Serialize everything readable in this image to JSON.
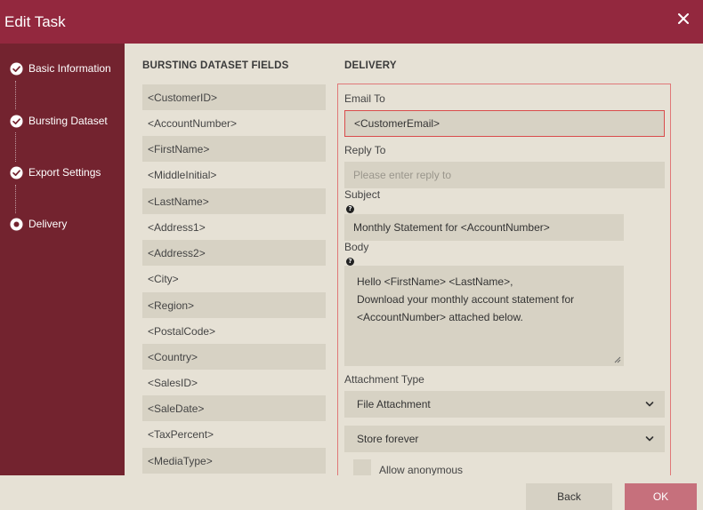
{
  "dialog": {
    "title": "Edit Task"
  },
  "steps": [
    {
      "label": "Basic Information",
      "state": "done"
    },
    {
      "label": "Bursting Dataset",
      "state": "done"
    },
    {
      "label": "Export Settings",
      "state": "done"
    },
    {
      "label": "Delivery",
      "state": "current"
    }
  ],
  "fields_panel": {
    "heading": "BURSTING DATASET FIELDS",
    "items": [
      "<CustomerID>",
      "<AccountNumber>",
      "<FirstName>",
      "<MiddleInitial>",
      "<LastName>",
      "<Address1>",
      "<Address2>",
      "<City>",
      "<Region>",
      "<PostalCode>",
      "<Country>",
      "<SalesID>",
      "<SaleDate>",
      "<TaxPercent>",
      "<MediaType>"
    ]
  },
  "delivery": {
    "heading": "DELIVERY",
    "email_to": {
      "label": "Email To",
      "value": "<CustomerEmail>"
    },
    "reply_to": {
      "label": "Reply To",
      "placeholder": "Please enter reply to"
    },
    "subject": {
      "label": "Subject",
      "value": "Monthly Statement for <AccountNumber>"
    },
    "body": {
      "label": "Body",
      "lines": [
        "Hello <FirstName> <LastName>,",
        "Download your monthly account statement for",
        "<AccountNumber> attached below."
      ]
    },
    "attachment_type": {
      "label": "Attachment Type",
      "selected": "File Attachment"
    },
    "storage": {
      "selected": "Store forever"
    },
    "allow_anonymous": {
      "label": "Allow anonymous",
      "checked": false
    }
  },
  "footer": {
    "back_label": "Back",
    "ok_label": "OK"
  },
  "colors": {
    "titlebar": "#93283e",
    "sidebar": "#73232f",
    "panel": "#e6e1d5",
    "input": "#d7d2c4",
    "ok_button": "#c6707c",
    "highlight_border": "#d94c4c"
  },
  "icons": {
    "close": "close-icon",
    "step_done": "check-circle-icon",
    "step_current": "radio-dot-icon",
    "help": "question-circle-icon",
    "dropdown": "chevron-down-icon"
  }
}
